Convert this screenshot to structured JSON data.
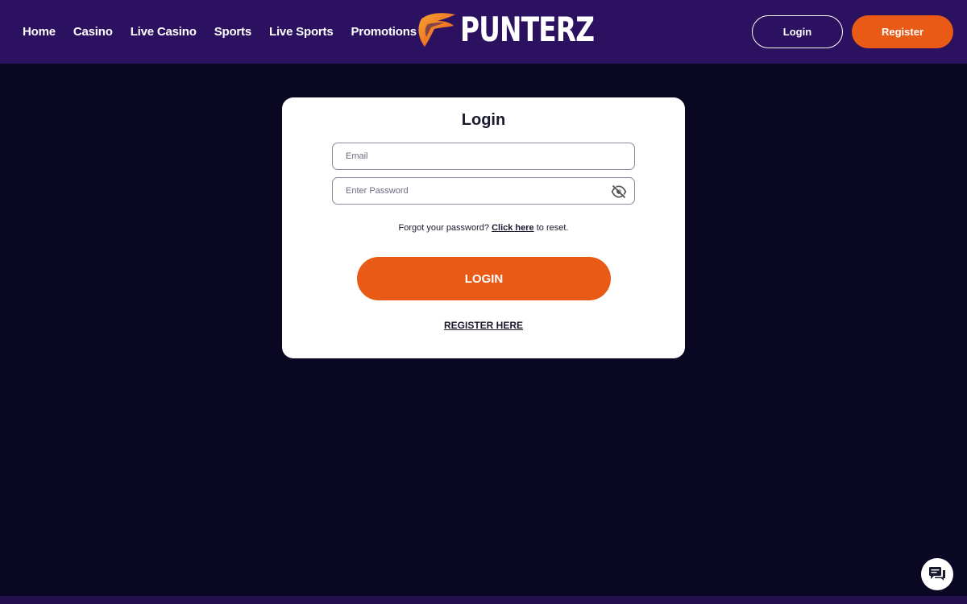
{
  "header": {
    "nav": [
      {
        "label": "Home"
      },
      {
        "label": "Casino"
      },
      {
        "label": "Live Casino"
      },
      {
        "label": "Sports"
      },
      {
        "label": "Live Sports"
      },
      {
        "label": "Promotions"
      }
    ],
    "logo_text": "PUNTERZ",
    "login_label": "Login",
    "register_label": "Register"
  },
  "login_form": {
    "title": "Login",
    "email_placeholder": "Email",
    "password_placeholder": "Enter Password",
    "forgot_prefix": "Forgot your password?",
    "forgot_link": "Click here",
    "forgot_suffix": "to reset.",
    "submit_label": "LOGIN",
    "register_link": "REGISTER HERE"
  },
  "icons": {
    "password_toggle": "eye-slash-icon",
    "chat": "chat-bubble-icon",
    "logo_mark": "flame-icon"
  },
  "colors": {
    "header_bg": "#2b1160",
    "page_bg": "#0a0722",
    "accent": "#e85a16",
    "card_bg": "#ffffff"
  }
}
